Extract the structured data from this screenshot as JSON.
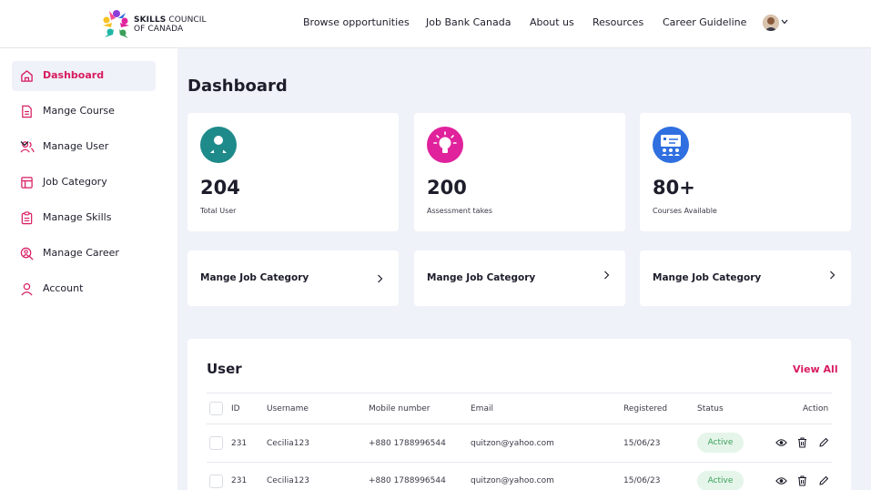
{
  "header": {
    "logo_line1": "SKILLS",
    "logo_line1b": "COUNCIL",
    "logo_line2": "OF CANADA",
    "nav": [
      "Browse opportunities",
      "Job Bank Canada",
      "About us",
      "Resources",
      "Career Guideline"
    ]
  },
  "sidebar": {
    "items": [
      {
        "label": "Dashboard",
        "icon": "home-icon"
      },
      {
        "label": "Mange Course",
        "icon": "document-icon"
      },
      {
        "label": "Manage User",
        "icon": "users-icon"
      },
      {
        "label": "Job Category",
        "icon": "table-icon"
      },
      {
        "label": "Manage Skills",
        "icon": "clipboard-icon"
      },
      {
        "label": "Manage Career",
        "icon": "user-search-icon"
      },
      {
        "label": "Account",
        "icon": "user-icon"
      }
    ]
  },
  "main": {
    "title": "Dashboard",
    "stats": [
      {
        "value": "204",
        "label": "Total User",
        "color": "#1f8a8a",
        "icon": "user-badge-icon"
      },
      {
        "value": "200",
        "label": "Assessment takes",
        "color": "#e0229c",
        "icon": "lightbulb-icon"
      },
      {
        "value": "80+",
        "label": "Courses Available",
        "color": "#2f6fe0",
        "icon": "presentation-icon"
      }
    ],
    "links": [
      "Mange Job Category",
      "Mange Job Category",
      "Mange Job Category"
    ]
  },
  "users": {
    "title": "User",
    "view_all": "View All",
    "columns": {
      "id": "ID",
      "username": "Username",
      "mobile": "Mobile number",
      "email": "Email",
      "registered": "Registered",
      "status": "Status",
      "action": "Action"
    },
    "rows": [
      {
        "id": "231",
        "username": "Cecilia123",
        "mobile": "+880 1788996544",
        "email": "quitzon@yahoo.com",
        "registered": "15/06/23",
        "status": "Active"
      },
      {
        "id": "231",
        "username": "Cecilia123",
        "mobile": "+880 1788996544",
        "email": "quitzon@yahoo.com",
        "registered": "15/06/23",
        "status": "Active"
      }
    ]
  },
  "colors": {
    "accent": "#d81b60",
    "background": "#eff2f8",
    "active_badge_bg": "#e5f5ea",
    "active_badge_text": "#3aa05a"
  }
}
